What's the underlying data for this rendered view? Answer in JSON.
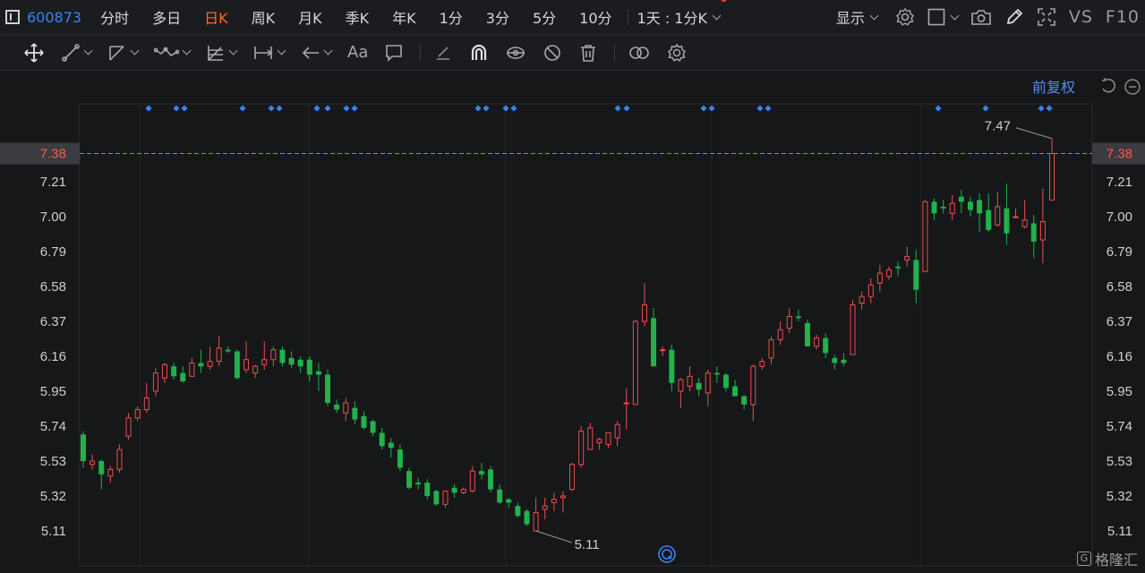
{
  "toolbar": {
    "stock_code": "600873",
    "tabs": [
      "分时",
      "多日",
      "日K",
      "周K",
      "月K",
      "季K",
      "年K",
      "1分",
      "3分",
      "5分",
      "10分"
    ],
    "active_tab": "日K",
    "period_selector": "1天 : 1分K",
    "display_label": "显示",
    "vs_label": "VS",
    "f10_label": "F10"
  },
  "drawing_tools": [
    "move-icon",
    "line-icon",
    "polyline-icon",
    "wave-icon",
    "fib-icon",
    "range-icon",
    "arrow-icon",
    "text-icon",
    "comment-icon",
    "eraser-icon",
    "magnet-icon",
    "lock-eye-icon",
    "hide-icon",
    "trash-icon",
    "link-icon",
    "settings-icon"
  ],
  "text_tool_label": "Aa",
  "adjust_label": "前复权",
  "watermark": {
    "badge": "G",
    "text": "格隆汇"
  },
  "colors": {
    "up": "#ef4d4d",
    "down": "#22b14c",
    "current": "#ff6a2b",
    "accent": "#3b82f6"
  },
  "price_axis": {
    "ticks": [
      "7.38",
      "7.21",
      "7.00",
      "6.79",
      "6.58",
      "6.37",
      "6.16",
      "5.95",
      "5.74",
      "5.53",
      "5.32",
      "5.11"
    ],
    "current_price": "7.38"
  },
  "annotations": {
    "high": "7.47",
    "low": "5.11"
  },
  "chart_data": {
    "type": "candlestick",
    "ylim": [
      5.0,
      7.6
    ],
    "grid": true,
    "current_price": 7.38,
    "candles": [
      [
        5.69,
        5.71,
        5.49,
        5.53
      ],
      [
        5.51,
        5.57,
        5.48,
        5.53
      ],
      [
        5.53,
        5.54,
        5.36,
        5.45
      ],
      [
        5.44,
        5.5,
        5.4,
        5.48
      ],
      [
        5.48,
        5.63,
        5.46,
        5.6
      ],
      [
        5.68,
        5.82,
        5.66,
        5.79
      ],
      [
        5.79,
        5.86,
        5.77,
        5.84
      ],
      [
        5.84,
        6.0,
        5.82,
        5.91
      ],
      [
        5.95,
        6.09,
        5.92,
        6.06
      ],
      [
        6.03,
        6.12,
        6.0,
        6.11
      ],
      [
        6.1,
        6.12,
        6.02,
        6.04
      ],
      [
        6.06,
        6.1,
        6.0,
        6.01
      ],
      [
        6.04,
        6.15,
        6.04,
        6.12
      ],
      [
        6.12,
        6.2,
        6.06,
        6.1
      ],
      [
        6.1,
        6.22,
        6.08,
        6.13
      ],
      [
        6.13,
        6.28,
        6.1,
        6.21
      ],
      [
        6.2,
        6.22,
        6.18,
        6.19
      ],
      [
        6.19,
        6.2,
        6.02,
        6.03
      ],
      [
        6.08,
        6.25,
        6.06,
        6.14
      ],
      [
        6.06,
        6.11,
        6.03,
        6.1
      ],
      [
        6.11,
        6.25,
        6.08,
        6.14
      ],
      [
        6.14,
        6.22,
        6.1,
        6.2
      ],
      [
        6.2,
        6.22,
        6.1,
        6.12
      ],
      [
        6.15,
        6.19,
        6.09,
        6.11
      ],
      [
        6.14,
        6.16,
        6.06,
        6.1
      ],
      [
        6.14,
        6.16,
        6.01,
        6.05
      ],
      [
        6.07,
        6.12,
        5.95,
        6.05
      ],
      [
        6.05,
        6.08,
        5.86,
        5.88
      ],
      [
        5.87,
        5.9,
        5.82,
        5.84
      ],
      [
        5.82,
        5.91,
        5.77,
        5.88
      ],
      [
        5.85,
        5.89,
        5.75,
        5.78
      ],
      [
        5.8,
        5.83,
        5.72,
        5.73
      ],
      [
        5.77,
        5.78,
        5.68,
        5.7
      ],
      [
        5.7,
        5.73,
        5.6,
        5.62
      ],
      [
        5.64,
        5.67,
        5.55,
        5.61
      ],
      [
        5.6,
        5.63,
        5.47,
        5.49
      ],
      [
        5.47,
        5.49,
        5.36,
        5.37
      ],
      [
        5.4,
        5.43,
        5.36,
        5.39
      ],
      [
        5.4,
        5.42,
        5.3,
        5.32
      ],
      [
        5.35,
        5.36,
        5.26,
        5.27
      ],
      [
        5.27,
        5.35,
        5.25,
        5.35
      ],
      [
        5.37,
        5.39,
        5.31,
        5.34
      ],
      [
        5.34,
        5.37,
        5.33,
        5.36
      ],
      [
        5.35,
        5.5,
        5.34,
        5.47
      ],
      [
        5.47,
        5.52,
        5.42,
        5.45
      ],
      [
        5.48,
        5.5,
        5.34,
        5.36
      ],
      [
        5.36,
        5.39,
        5.27,
        5.28
      ],
      [
        5.3,
        5.31,
        5.25,
        5.28
      ],
      [
        5.26,
        5.28,
        5.19,
        5.2
      ],
      [
        5.23,
        5.24,
        5.14,
        5.15
      ],
      [
        5.11,
        5.31,
        5.11,
        5.22
      ],
      [
        5.24,
        5.31,
        5.18,
        5.26
      ],
      [
        5.28,
        5.34,
        5.23,
        5.3
      ],
      [
        5.31,
        5.35,
        5.22,
        5.32
      ],
      [
        5.36,
        5.52,
        5.35,
        5.51
      ],
      [
        5.51,
        5.74,
        5.49,
        5.71
      ],
      [
        5.6,
        5.76,
        5.6,
        5.73
      ],
      [
        5.64,
        5.67,
        5.6,
        5.66
      ],
      [
        5.63,
        5.7,
        5.61,
        5.7
      ],
      [
        5.67,
        5.77,
        5.62,
        5.75
      ],
      [
        5.88,
        5.97,
        5.72,
        5.88
      ],
      [
        5.87,
        6.38,
        5.87,
        6.37
      ],
      [
        6.37,
        6.6,
        6.34,
        6.47
      ],
      [
        6.39,
        6.45,
        6.1,
        6.1
      ],
      [
        6.2,
        6.22,
        6.16,
        6.2
      ],
      [
        6.2,
        6.23,
        5.95,
        6.0
      ],
      [
        5.95,
        6.03,
        5.85,
        6.02
      ],
      [
        5.98,
        6.1,
        5.95,
        6.04
      ],
      [
        6.0,
        6.03,
        5.92,
        5.96
      ],
      [
        5.94,
        6.08,
        5.86,
        6.06
      ],
      [
        6.06,
        6.1,
        6.0,
        6.05
      ],
      [
        6.05,
        6.06,
        5.95,
        5.97
      ],
      [
        5.98,
        6.02,
        5.92,
        5.92
      ],
      [
        5.92,
        5.93,
        5.84,
        5.87
      ],
      [
        5.87,
        6.11,
        5.77,
        6.1
      ],
      [
        6.1,
        6.15,
        6.08,
        6.13
      ],
      [
        6.15,
        6.28,
        6.11,
        6.26
      ],
      [
        6.26,
        6.37,
        6.23,
        6.32
      ],
      [
        6.33,
        6.45,
        6.3,
        6.4
      ],
      [
        6.4,
        6.44,
        6.37,
        6.39
      ],
      [
        6.36,
        6.38,
        6.22,
        6.22
      ],
      [
        6.22,
        6.29,
        6.2,
        6.27
      ],
      [
        6.27,
        6.3,
        6.15,
        6.18
      ],
      [
        6.15,
        6.17,
        6.08,
        6.12
      ],
      [
        6.14,
        6.18,
        6.1,
        6.12
      ],
      [
        6.17,
        6.5,
        6.17,
        6.47
      ],
      [
        6.48,
        6.55,
        6.44,
        6.52
      ],
      [
        6.52,
        6.63,
        6.48,
        6.59
      ],
      [
        6.6,
        6.71,
        6.55,
        6.66
      ],
      [
        6.64,
        6.7,
        6.62,
        6.68
      ],
      [
        6.7,
        6.73,
        6.64,
        6.69
      ],
      [
        6.74,
        6.82,
        6.7,
        6.76
      ],
      [
        6.74,
        6.8,
        6.48,
        6.56
      ],
      [
        6.67,
        7.1,
        6.67,
        7.09
      ],
      [
        7.09,
        7.11,
        6.98,
        7.02
      ],
      [
        7.06,
        7.1,
        7.02,
        7.05
      ],
      [
        7.02,
        7.13,
        6.98,
        7.08
      ],
      [
        7.12,
        7.16,
        7.02,
        7.09
      ],
      [
        7.09,
        7.12,
        7.0,
        7.04
      ],
      [
        7.1,
        7.14,
        6.91,
        7.02
      ],
      [
        7.04,
        7.14,
        6.91,
        6.92
      ],
      [
        6.95,
        7.15,
        6.94,
        7.06
      ],
      [
        7.05,
        7.2,
        6.83,
        6.9
      ],
      [
        7.0,
        7.05,
        6.99,
        7.0
      ],
      [
        6.94,
        7.1,
        6.93,
        6.98
      ],
      [
        6.96,
        7.01,
        6.75,
        6.85
      ],
      [
        6.86,
        7.17,
        6.72,
        6.97
      ],
      [
        7.1,
        7.47,
        7.1,
        7.38
      ]
    ]
  }
}
